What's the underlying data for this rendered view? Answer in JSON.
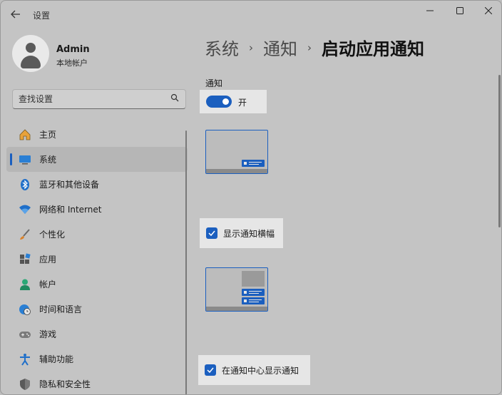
{
  "window": {
    "title": "设置",
    "back_icon": "arrow-left-icon",
    "controls": [
      "minimize-icon",
      "maximize-icon",
      "close-icon"
    ]
  },
  "profile": {
    "name": "Admin",
    "account_type": "本地帐户"
  },
  "search": {
    "placeholder": "查找设置",
    "icon": "search-icon"
  },
  "sidebar": {
    "items": [
      {
        "label": "主页",
        "icon": "home-icon",
        "active": false
      },
      {
        "label": "系统",
        "icon": "display-icon",
        "active": true
      },
      {
        "label": "蓝牙和其他设备",
        "icon": "bluetooth-icon",
        "active": false
      },
      {
        "label": "网络和 Internet",
        "icon": "wifi-icon",
        "active": false
      },
      {
        "label": "个性化",
        "icon": "brush-icon",
        "active": false
      },
      {
        "label": "应用",
        "icon": "apps-icon",
        "active": false
      },
      {
        "label": "帐户",
        "icon": "person-icon",
        "active": false
      },
      {
        "label": "时间和语言",
        "icon": "globe-clock-icon",
        "active": false
      },
      {
        "label": "游戏",
        "icon": "gamepad-icon",
        "active": false
      },
      {
        "label": "辅助功能",
        "icon": "accessibility-icon",
        "active": false
      },
      {
        "label": "隐私和安全性",
        "icon": "shield-icon",
        "active": false
      }
    ]
  },
  "main": {
    "breadcrumb": [
      "系统",
      "通知",
      "启动应用通知"
    ],
    "section_label": "通知",
    "toggle": {
      "label": "开",
      "on": true
    },
    "options": [
      {
        "label": "显示通知横幅",
        "checked": true
      },
      {
        "label": "在通知中心显示通知",
        "checked": true
      }
    ]
  },
  "colors": {
    "accent": "#1b5fbf",
    "background": "#c4c4c4"
  }
}
